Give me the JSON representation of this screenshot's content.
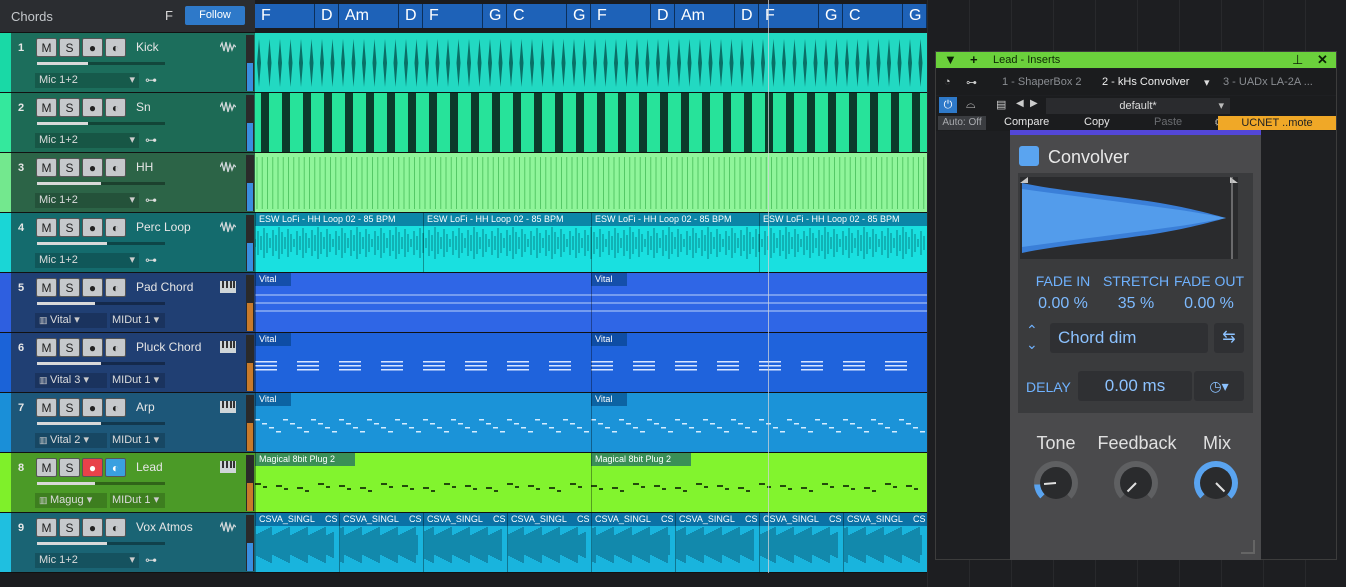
{
  "header": {
    "title": "Chords",
    "key": "F",
    "follow_label": "Follow"
  },
  "chords": [
    {
      "label": "F",
      "w": 60
    },
    {
      "label": "D",
      "w": 24
    },
    {
      "label": "Am",
      "w": 60
    },
    {
      "label": "D",
      "w": 24
    },
    {
      "label": "F",
      "w": 60
    },
    {
      "label": "G",
      "w": 24
    },
    {
      "label": "C",
      "w": 60
    },
    {
      "label": "G",
      "w": 24
    },
    {
      "label": "F",
      "w": 60
    },
    {
      "label": "D",
      "w": 24
    },
    {
      "label": "Am",
      "w": 60
    },
    {
      "label": "D",
      "w": 24
    },
    {
      "label": "F",
      "w": 60
    },
    {
      "label": "G",
      "w": 24
    },
    {
      "label": "C",
      "w": 60
    },
    {
      "label": "G",
      "w": 24
    }
  ],
  "tracks": [
    {
      "num": "1",
      "name": "Kick",
      "input": "Mic 1+2",
      "type": "audio",
      "color": "#1c6e5c",
      "strip": "#19d9a6",
      "vol": 0.4
    },
    {
      "num": "2",
      "name": "Sn",
      "input": "Mic 1+2",
      "type": "audio",
      "color": "#1d6a55",
      "strip": "#34e89d",
      "vol": 0.4
    },
    {
      "num": "3",
      "name": "HH",
      "input": "Mic 1+2",
      "type": "audio",
      "color": "#2c6447",
      "strip": "#73e88e",
      "vol": 0.5
    },
    {
      "num": "4",
      "name": "Perc Loop",
      "input": "Mic 1+2",
      "type": "audio",
      "color": "#146b6d",
      "strip": "#1ad6d6",
      "vol": 0.55
    },
    {
      "num": "5",
      "name": "Pad Chord",
      "input": "Vital",
      "midi": "MIDut 1",
      "type": "inst",
      "color": "#203f73",
      "strip": "#2e5fe0",
      "vol": 0.45
    },
    {
      "num": "6",
      "name": "Pluck Chord",
      "input": "Vital 3",
      "midi": "MIDut 1",
      "type": "inst",
      "color": "#203f73",
      "strip": "#1b63d8",
      "vol": 0.5
    },
    {
      "num": "7",
      "name": "Arp",
      "input": "Vital 2",
      "midi": "MIDut 1",
      "type": "inst",
      "color": "#1d5779",
      "strip": "#1a8fd8",
      "vol": 0.5
    },
    {
      "num": "8",
      "name": "Lead",
      "input": "Magug",
      "midi": "MIDut 1",
      "type": "inst",
      "color": "#4b9a27",
      "strip": "#7ff02a",
      "vol": 0.45,
      "armed": true
    },
    {
      "num": "9",
      "name": "Vox Atmos",
      "input": "Mic 1+2",
      "type": "audio",
      "color": "#1a6474",
      "strip": "#1fbfe0",
      "vol": 0.55
    }
  ],
  "clip_labels": {
    "perc": "ESW LoFi - HH Loop 02 - 85 BPM",
    "vital": "Vital",
    "magical": "Magical 8bit Plug 2",
    "csva": "CSVA_SINGL",
    "csva_short": "CS"
  },
  "inserts": {
    "title": "Lead - Inserts",
    "tabs": [
      "1 - ShaperBox 2",
      "2 - kHs Convolver",
      "3 - UADx LA-2A ..."
    ],
    "preset": "default*",
    "auto": "Auto: Off",
    "compare": "Compare",
    "copy": "Copy",
    "paste": "Paste",
    "ucnet": "UCNET ..mote"
  },
  "plugin": {
    "name": "Convolver",
    "fade_in_label": "FADE IN",
    "fade_in": "0.00 %",
    "stretch_label": "STRETCH",
    "stretch": "35 %",
    "fade_out_label": "FADE OUT",
    "fade_out": "0.00 %",
    "ir": "Chord dim",
    "delay_label": "DELAY",
    "delay": "0.00 ms",
    "tone_label": "Tone",
    "feedback_label": "Feedback",
    "mix_label": "Mix",
    "tone": 0.15,
    "feedback": 0.0,
    "mix": 1.0
  },
  "colors": {
    "accent": "#2e79c9",
    "plugin_accent": "#5aa4f0",
    "inserts_bar": "#6bd13c",
    "ucnet": "#f0a827"
  }
}
